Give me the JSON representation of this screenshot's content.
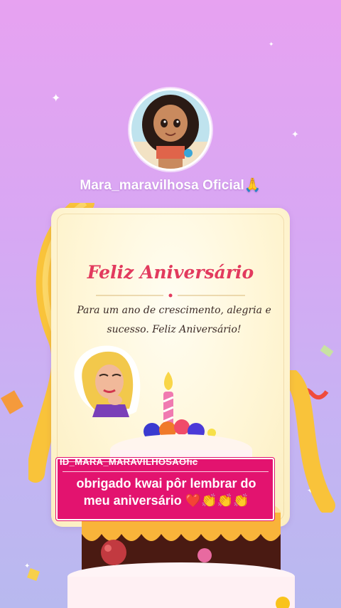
{
  "profile": {
    "username": "Mara_maravilhosa Oficial🙏"
  },
  "card": {
    "title": "Feliz Aniversário",
    "message_line1": "Para um ano de crescimento, alegria e",
    "message_line2": "sucesso. Feliz Aniversário!"
  },
  "caption": {
    "id_text": "ID_MARA_MARAVILHOSAOfic",
    "line1": "obrigado kwai pôr lembrar do",
    "line2": "meu aniversário ❤️👏👏👏"
  },
  "colors": {
    "background_top": "#e7a2f1",
    "background_bottom": "#b8b9ef",
    "title": "#e23a5e",
    "caption_box": "#e3136f"
  }
}
